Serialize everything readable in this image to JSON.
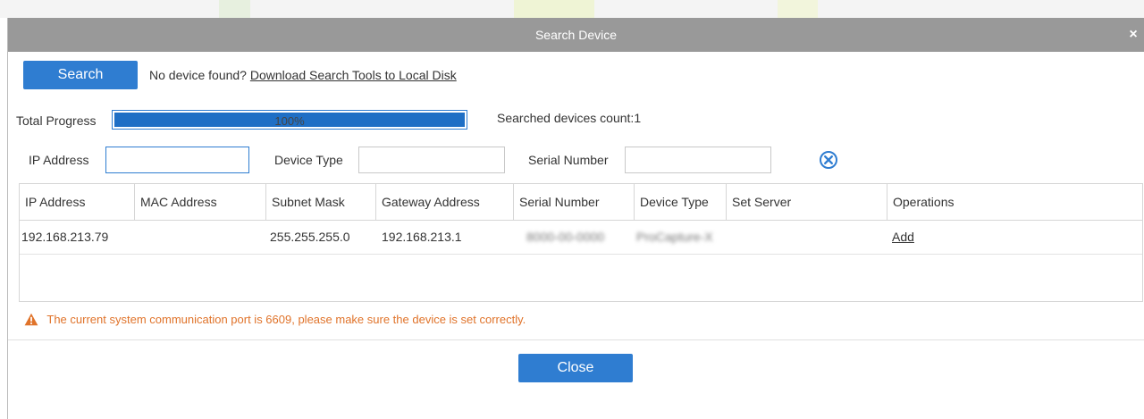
{
  "dialog": {
    "title": "Search Device",
    "close_symbol": "×",
    "search_button": "Search",
    "no_device_text": "No device found?",
    "download_link": "Download Search Tools to Local Disk",
    "progress_label": "Total Progress",
    "progress_value": 1.0,
    "progress_text": "100%",
    "searched_count_text": "Searched devices count:1",
    "filters": {
      "ip_label": "IP Address",
      "ip_value": "",
      "type_label": "Device Type",
      "type_value": "",
      "serial_label": "Serial Number",
      "serial_value": ""
    },
    "clear_icon": "circle-x-icon",
    "table": {
      "headers": [
        "IP Address",
        "MAC Address",
        "Subnet Mask",
        "Gateway Address",
        "Serial Number",
        "Device Type",
        "Set Server",
        "Operations"
      ],
      "rows": [
        {
          "ip": "192.168.213.79",
          "mac": "",
          "subnet": "255.255.255.0",
          "gateway": "192.168.213.1",
          "serial": "8000-00-0000",
          "device_type": "ProCapture-X",
          "set_server": "",
          "operation": "Add"
        }
      ]
    },
    "warning_text": "The current system communication port is 6609, please make sure the device is set correctly.",
    "close_button": "Close"
  },
  "colors": {
    "titlebar": "#999999",
    "primary": "#2f7dd1",
    "warning": "#e0732a"
  }
}
